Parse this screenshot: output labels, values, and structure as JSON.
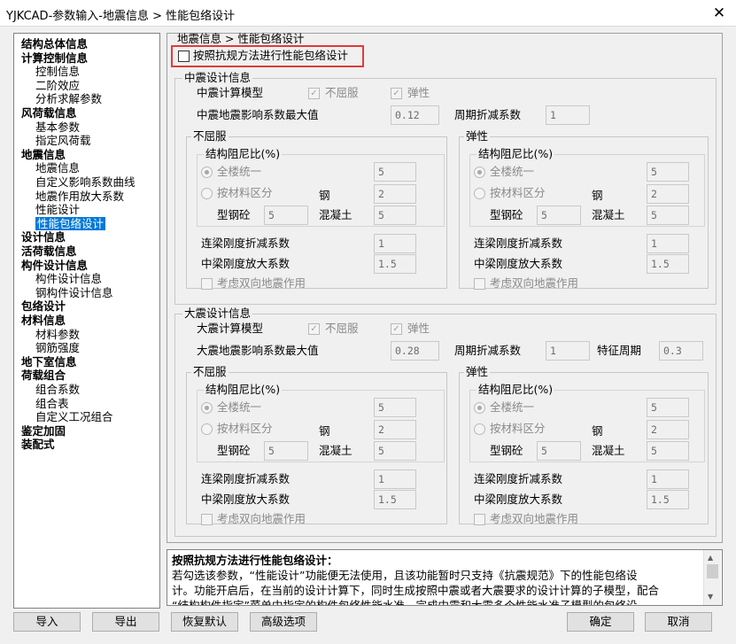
{
  "window": {
    "title": "YJKCAD-参数输入-地震信息 > 性能包络设计",
    "close_icon": "✕"
  },
  "tree": [
    {
      "label": "结构总体信息",
      "level": 0
    },
    {
      "label": "计算控制信息",
      "level": 0
    },
    {
      "label": "控制信息",
      "level": 1
    },
    {
      "label": "二阶效应",
      "level": 1
    },
    {
      "label": "分析求解参数",
      "level": 1
    },
    {
      "label": "风荷载信息",
      "level": 0
    },
    {
      "label": "基本参数",
      "level": 1
    },
    {
      "label": "指定风荷载",
      "level": 1
    },
    {
      "label": "地震信息",
      "level": 0
    },
    {
      "label": "地震信息",
      "level": 1
    },
    {
      "label": "自定义影响系数曲线",
      "level": 1
    },
    {
      "label": "地震作用放大系数",
      "level": 1
    },
    {
      "label": "性能设计",
      "level": 1
    },
    {
      "label": "性能包络设计",
      "level": 1,
      "selected": true
    },
    {
      "label": "设计信息",
      "level": 0
    },
    {
      "label": "活荷载信息",
      "level": 0
    },
    {
      "label": "构件设计信息",
      "level": 0
    },
    {
      "label": "构件设计信息",
      "level": 1
    },
    {
      "label": "钢构件设计信息",
      "level": 1
    },
    {
      "label": "包络设计",
      "level": 0
    },
    {
      "label": "材料信息",
      "level": 0
    },
    {
      "label": "材料参数",
      "level": 1
    },
    {
      "label": "钢筋强度",
      "level": 1
    },
    {
      "label": "地下室信息",
      "level": 0
    },
    {
      "label": "荷载组合",
      "level": 0
    },
    {
      "label": "组合系数",
      "level": 1
    },
    {
      "label": "组合表",
      "level": 1
    },
    {
      "label": "自定义工况组合",
      "level": 1
    },
    {
      "label": "鉴定加固",
      "level": 0
    },
    {
      "label": "装配式",
      "level": 0
    }
  ],
  "breadcrumb": "地震信息 > 性能包络设计",
  "main_checkbox": {
    "label": "按照抗规方法进行性能包络设计",
    "checked": false
  },
  "mid": {
    "title": "中震设计信息",
    "model_label": "中震计算模型",
    "model_opt1": "不屈服",
    "model_opt2": "弹性",
    "alpha_label": "中震地震影响系数最大值",
    "alpha_value": "0.12",
    "period_label": "周期折减系数",
    "period_value": "1",
    "nonyield": {
      "title": "不屈服",
      "damp_title": "结构阻尼比(%)",
      "opt_all": "全楼统一",
      "opt_all_value": "5",
      "opt_mat": "按材料区分",
      "steel_label": "钢",
      "steel_value": "2",
      "src_label": "型钢砼",
      "src_value": "5",
      "conc_label": "混凝土",
      "conc_value": "5",
      "beam_red_label": "连梁刚度折减系数",
      "beam_red_value": "1",
      "beam_amp_label": "中梁刚度放大系数",
      "beam_amp_value": "1.5",
      "bidir_label": "考虑双向地震作用"
    },
    "elastic": {
      "title": "弹性",
      "damp_title": "结构阻尼比(%)",
      "opt_all": "全楼统一",
      "opt_all_value": "5",
      "opt_mat": "按材料区分",
      "steel_label": "钢",
      "steel_value": "2",
      "src_label": "型钢砼",
      "src_value": "5",
      "conc_label": "混凝土",
      "conc_value": "5",
      "beam_red_label": "连梁刚度折减系数",
      "beam_red_value": "1",
      "beam_amp_label": "中梁刚度放大系数",
      "beam_amp_value": "1.5",
      "bidir_label": "考虑双向地震作用"
    }
  },
  "large": {
    "title": "大震设计信息",
    "model_label": "大震计算模型",
    "model_opt1": "不屈服",
    "model_opt2": "弹性",
    "alpha_label": "大震地震影响系数最大值",
    "alpha_value": "0.28",
    "period_label": "周期折减系数",
    "period_value": "1",
    "char_label": "特征周期",
    "char_value": "0.3",
    "nonyield": {
      "title": "不屈服",
      "damp_title": "结构阻尼比(%)",
      "opt_all": "全楼统一",
      "opt_all_value": "5",
      "opt_mat": "按材料区分",
      "steel_label": "钢",
      "steel_value": "2",
      "src_label": "型钢砼",
      "src_value": "5",
      "conc_label": "混凝土",
      "conc_value": "5",
      "beam_red_label": "连梁刚度折减系数",
      "beam_red_value": "1",
      "beam_amp_label": "中梁刚度放大系数",
      "beam_amp_value": "1.5",
      "bidir_label": "考虑双向地震作用"
    },
    "elastic": {
      "title": "弹性",
      "damp_title": "结构阻尼比(%)",
      "opt_all": "全楼统一",
      "opt_all_value": "5",
      "opt_mat": "按材料区分",
      "steel_label": "钢",
      "steel_value": "2",
      "src_label": "型钢砼",
      "src_value": "5",
      "conc_label": "混凝土",
      "conc_value": "5",
      "beam_red_label": "连梁刚度折减系数",
      "beam_red_value": "1",
      "beam_amp_label": "中梁刚度放大系数",
      "beam_amp_value": "1.5",
      "bidir_label": "考虑双向地震作用"
    }
  },
  "description": {
    "title": "按照抗规方法进行性能包络设计：",
    "line1": "若勾选该参数，“性能设计”功能便无法使用，且该功能暂时只支持《抗震规范》下的性能包络设",
    "line2": "计。功能开启后，在当前的设计计算下，同时生成按照中震或者大震要求的设计计算的子模型，配合",
    "line3": "“结构构件指定”菜单中指定的构件包络性能水准，完成中震和大震多个性能水准子模型的包络设"
  },
  "buttons": {
    "import": "导入",
    "export": "导出",
    "restore": "恢复默认",
    "advanced": "高级选项",
    "ok": "确定",
    "cancel": "取消"
  }
}
